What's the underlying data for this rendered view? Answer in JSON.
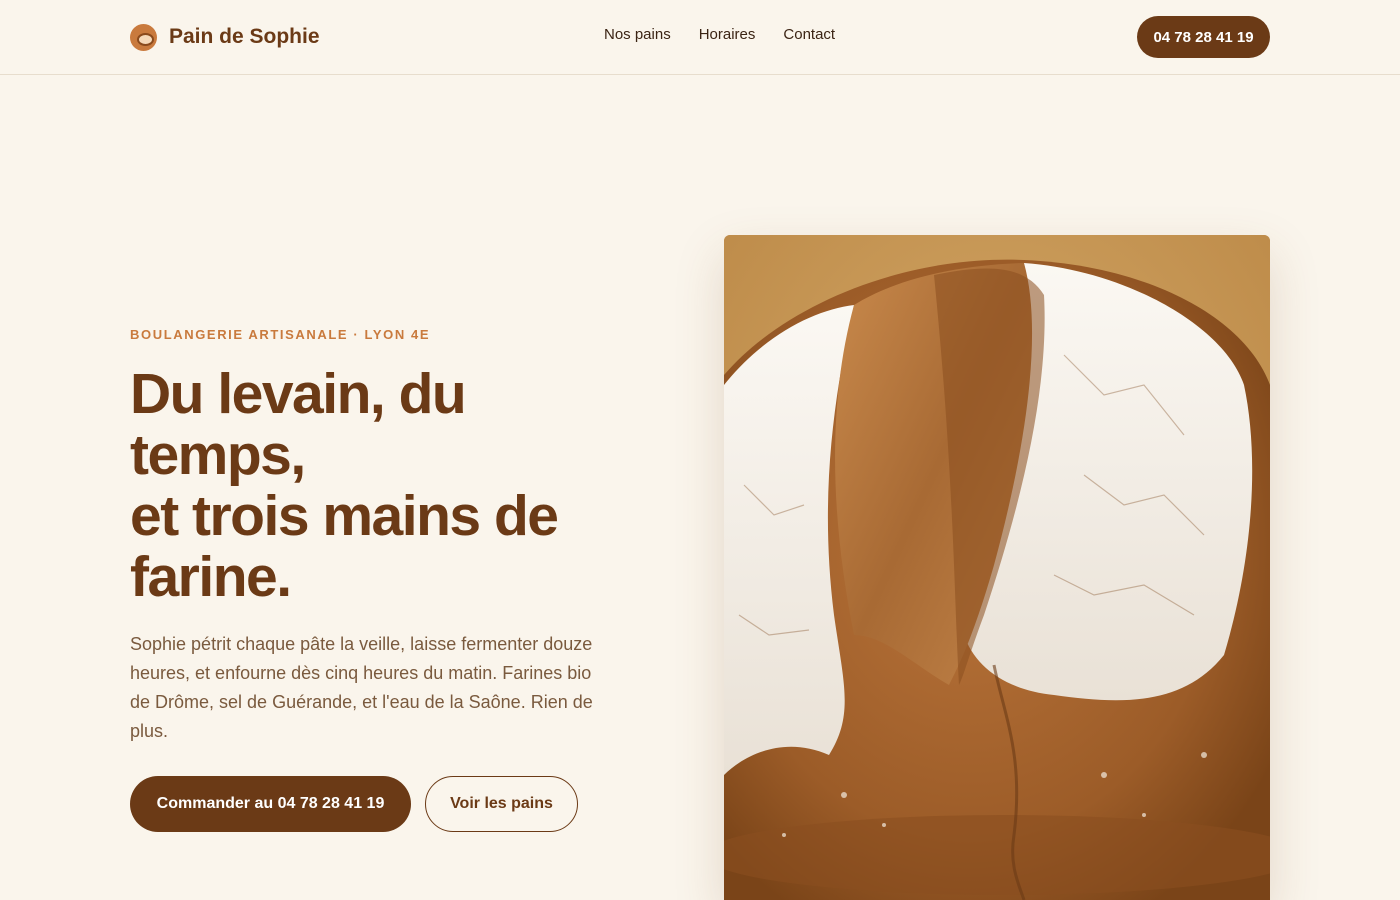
{
  "header": {
    "brand_name": "Pain de Sophie",
    "logo_icon": "bread-logo-icon",
    "nav": [
      "Nos pains",
      "Horaires",
      "Contact"
    ],
    "phone_button": "04 78 28 41 19"
  },
  "hero": {
    "eyebrow": "BOULANGERIE ARTISANALE · LYON 4E",
    "title_lines": [
      "Du levain, du",
      "temps,",
      "et trois mains de",
      "farine."
    ],
    "text": "Sophie pétrit chaque pâte la veille, laisse fermenter douze heures, et enfourne dès cinq heures du matin. Farines bio de Drôme, sel de Guérande, et l'eau de la Saône. Rien de plus.",
    "primary_button": "Commander au 04 78 28 41 19",
    "secondary_button": "Voir les pains",
    "image": "sourdough-loaf-photo"
  },
  "colors": {
    "background": "#faf5ec",
    "brand_brown": "#6b3a16",
    "accent_orange": "#c97a3d",
    "body_text": "#7a5a3e"
  }
}
